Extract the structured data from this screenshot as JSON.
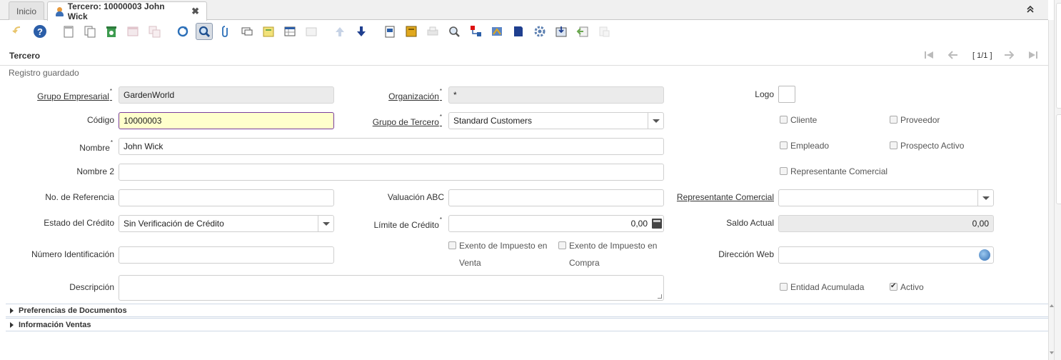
{
  "tabs": [
    {
      "label": "Inicio"
    },
    {
      "label": "Tercero: 10000003 John Wick",
      "close": "✖"
    }
  ],
  "collapse_glyph": "⌃⌃",
  "toolbar_icons": [
    "undo-icon",
    "help-icon",
    "new-record-icon",
    "copy-record-icon",
    "delete-icon",
    "delete-selection-icon",
    "save-icon",
    "refresh-icon",
    "find-icon",
    "attachment-icon",
    "chat-icon",
    "archive-icon",
    "grid-toggle-icon",
    "print-preview-icon",
    "previous-record-icon",
    "next-record-icon",
    "report-icon",
    "zoom-across-icon",
    "print-icon",
    "product-info-icon",
    "workflow-icon",
    "history-icon",
    "ask-ai-icon",
    "process-icon",
    "customize-icon",
    "export-icon",
    "import-icon",
    "quick-entry-icon"
  ],
  "window": {
    "title": "Tercero",
    "record_count": "[ 1/1 ]",
    "status": "Registro guardado"
  },
  "fields": {
    "grupo_empresarial": {
      "label": "Grupo Empresarial",
      "value": "GardenWorld"
    },
    "organizacion": {
      "label": "Organización",
      "value": "*"
    },
    "logo": {
      "label": "Logo"
    },
    "codigo": {
      "label": "Código",
      "value": "10000003"
    },
    "grupo_tercero": {
      "label": "Grupo de Tercero",
      "value": "Standard Customers"
    },
    "nombre": {
      "label": "Nombre",
      "value": "John Wick"
    },
    "nombre2": {
      "label": "Nombre 2",
      "value": ""
    },
    "referencia": {
      "label": "No. de Referencia",
      "value": ""
    },
    "valuacion": {
      "label": "Valuación ABC",
      "value": ""
    },
    "representante": {
      "label": "Representante Comercial",
      "value": ""
    },
    "estado_credito": {
      "label": "Estado del Crédito",
      "value": "Sin Verificación de Crédito"
    },
    "limite_credito": {
      "label": "Límite de Crédito",
      "value": "0,00"
    },
    "saldo_actual": {
      "label": "Saldo Actual",
      "value": "0,00"
    },
    "numero_id": {
      "label": "Número Identificación",
      "value": ""
    },
    "direccion_web": {
      "label": "Dirección Web",
      "value": ""
    },
    "descripcion": {
      "label": "Descripción",
      "value": ""
    }
  },
  "checkboxes": {
    "cliente": {
      "label": "Cliente",
      "checked": false
    },
    "proveedor": {
      "label": "Proveedor",
      "checked": false
    },
    "empleado": {
      "label": "Empleado",
      "checked": false
    },
    "prospecto": {
      "label": "Prospecto Activo",
      "checked": false
    },
    "rep_comercial": {
      "label": "Representante Comercial",
      "checked": false
    },
    "exento_venta": {
      "label": "Exento de Impuesto en Venta",
      "checked": false
    },
    "exento_compra": {
      "label": "Exento de Impuesto en Compra",
      "checked": false
    },
    "entidad_acumulada": {
      "label": "Entidad Acumulada",
      "checked": false
    },
    "activo": {
      "label": "Activo",
      "checked": true
    }
  },
  "sections": [
    {
      "label": "Preferencias de Documentos"
    },
    {
      "label": "Información Ventas"
    }
  ],
  "colors": {
    "accent": "#7a3e9d",
    "focus_bg": "#ffffcc",
    "readonly_bg": "#ebebeb"
  }
}
